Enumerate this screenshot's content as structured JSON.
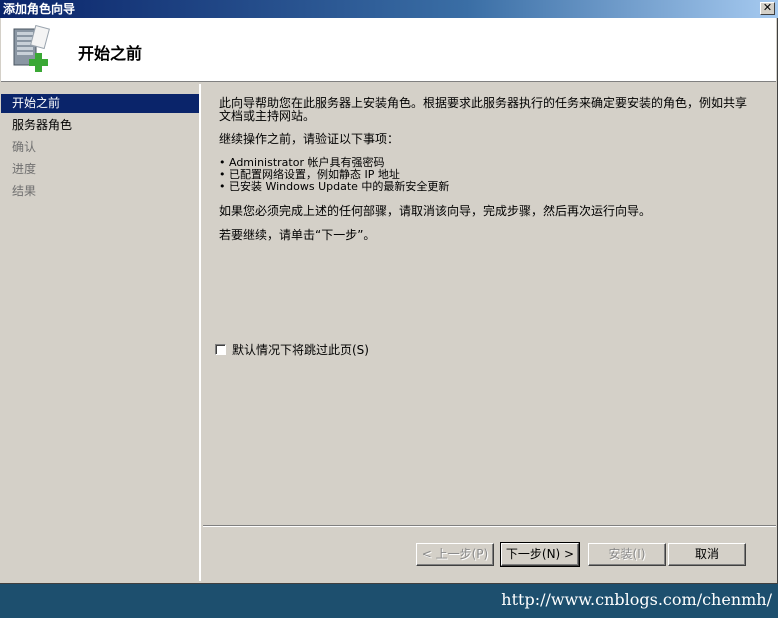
{
  "window": {
    "title": "添加角色向导",
    "close_symbol": "✕"
  },
  "header": {
    "title": "开始之前",
    "icon": "server-add-icon"
  },
  "sidebar": {
    "items": [
      {
        "label": "开始之前",
        "state": "active"
      },
      {
        "label": "服务器角色",
        "state": "normal"
      },
      {
        "label": "确认",
        "state": "disabled"
      },
      {
        "label": "进度",
        "state": "disabled"
      },
      {
        "label": "结果",
        "state": "disabled"
      }
    ]
  },
  "content": {
    "intro_line1": "此向导帮助您在此服务器上安装角色。根据要求此服务器执行的任务来确定要安装的角色，例如共享",
    "intro_line2": "文档或主持网站。",
    "before": "继续操作之前，请验证以下事项：",
    "bullets": [
      "• Administrator 帐户具有强密码",
      "• 已配置网络设置，例如静态 IP 地址",
      "• 已安装 Windows Update 中的最新安全更新"
    ],
    "if_must": "如果您必须完成上述的任何部骤，请取消该向导，完成步骤，然后再次运行向导。",
    "to_continue": "若要继续，请单击“下一步”。",
    "skip_label": "默认情况下将跳过此页(S)",
    "skip_checked": false
  },
  "buttons": {
    "back": "< 上一步(P)",
    "next": "下一步(N) >",
    "install": "安装(I)",
    "cancel": "取消"
  },
  "watermark": "http://www.cnblogs.com/chenmh/",
  "colors": {
    "title_bar": "#0a246a",
    "selection": "#0a246a",
    "window_bg": "#d4d0c8",
    "desktop": "#1d4f6e"
  }
}
